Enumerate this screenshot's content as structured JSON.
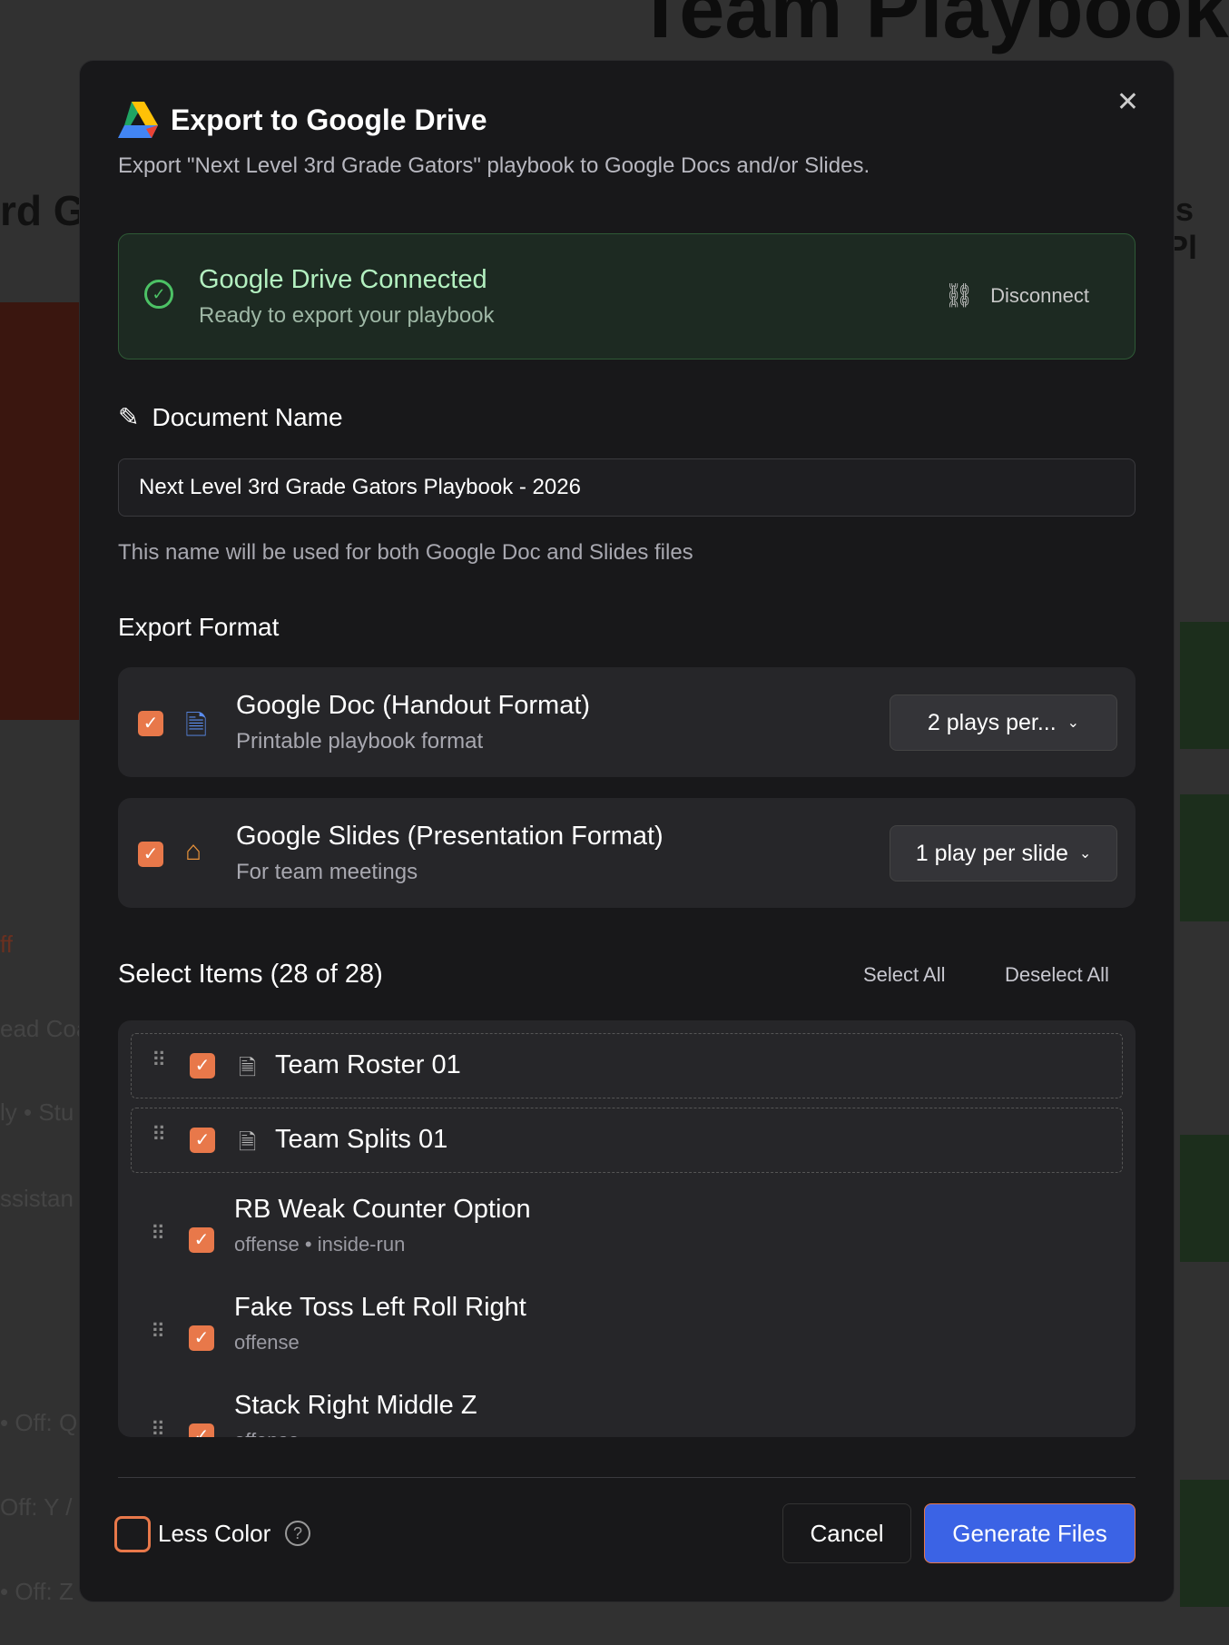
{
  "background": {
    "page_title": "Team Playbook",
    "left_fragment": "rd Gr",
    "right_fragment": "is Pl",
    "fragments": [
      "ff",
      "ead Coa",
      "ly  • Stu",
      "ssistan",
      "• Off: Q",
      "Off: Y / Z",
      "• Off: Z"
    ]
  },
  "dialog": {
    "title": "Export to Google Drive",
    "subtitle": "Export \"Next Level 3rd Grade Gators\" playbook to Google Docs and/or Slides.",
    "close_label": "✕",
    "connection": {
      "title": "Google Drive Connected",
      "subtitle": "Ready to export your playbook",
      "disconnect_label": "Disconnect"
    },
    "document_name": {
      "label": "Document Name",
      "value": "Next Level 3rd Grade Gators Playbook - 2026",
      "help": "This name will be used for both Google Doc and Slides files"
    },
    "export_format": {
      "label": "Export Format",
      "options": [
        {
          "title": "Google Doc (Handout Format)",
          "subtitle": "Printable playbook format",
          "checked": true,
          "select_value": "2 plays per...",
          "icon": "document-icon"
        },
        {
          "title": "Google Slides (Presentation Format)",
          "subtitle": "For team meetings",
          "checked": true,
          "select_value": "1 play per slide",
          "icon": "presentation-icon"
        }
      ]
    },
    "select_items": {
      "heading": "Select Items (28 of 28)",
      "select_all": "Select All",
      "deselect_all": "Deselect All",
      "items": [
        {
          "title": "Team Roster 01",
          "checked": true
        },
        {
          "title": "Team Splits 01",
          "checked": true
        },
        {
          "title": "RB Weak Counter Option",
          "subtitle": "offense • inside-run",
          "checked": true
        },
        {
          "title": "Fake Toss Left Roll Right",
          "subtitle": "offense",
          "checked": true
        },
        {
          "title": "Stack Right Middle Z",
          "subtitle": "offense",
          "checked": true
        }
      ]
    },
    "footer": {
      "less_color_label": "Less Color",
      "less_color_checked": false,
      "cancel_label": "Cancel",
      "generate_label": "Generate Files"
    }
  },
  "colors": {
    "accent": "#e8784a",
    "primary": "#3b63e5",
    "success": "#4cc265"
  }
}
